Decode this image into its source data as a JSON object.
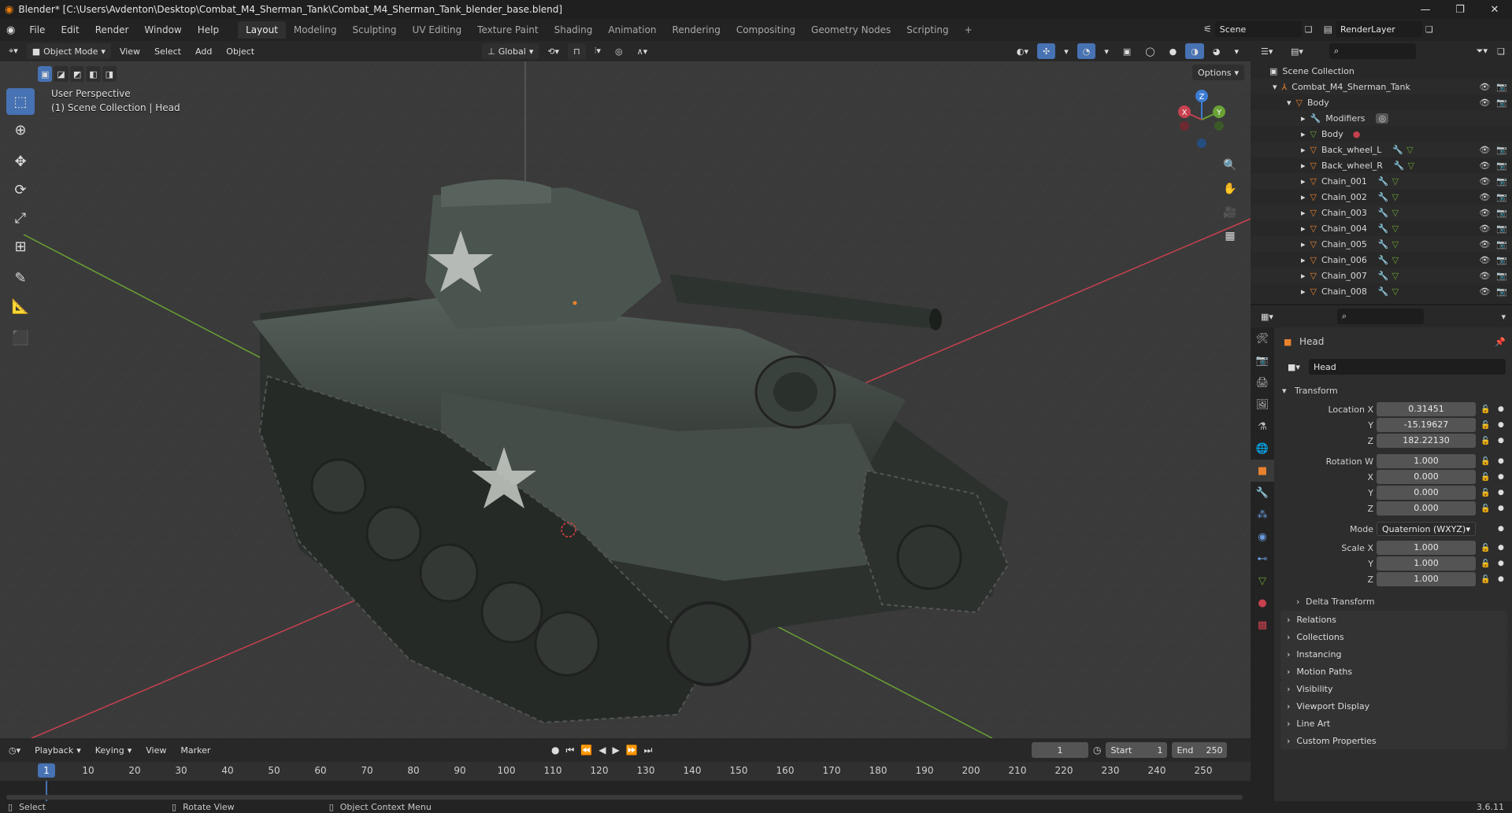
{
  "window": {
    "title": "Blender* [C:\\Users\\Avdenton\\Desktop\\Combat_M4_Sherman_Tank\\Combat_M4_Sherman_Tank_blender_base.blend]",
    "controls": [
      "—",
      "❐",
      "✕"
    ]
  },
  "menubar": {
    "menus": [
      "File",
      "Edit",
      "Render",
      "Window",
      "Help"
    ],
    "workspaces": [
      "Layout",
      "Modeling",
      "Sculpting",
      "UV Editing",
      "Texture Paint",
      "Shading",
      "Animation",
      "Rendering",
      "Compositing",
      "Geometry Nodes",
      "Scripting"
    ],
    "active_workspace": "Layout",
    "add_tab": "+",
    "scene": "Scene",
    "render_layer": "RenderLayer"
  },
  "viewport_header": {
    "mode": "Object Mode",
    "menus": [
      "View",
      "Select",
      "Add",
      "Object"
    ],
    "orientation": "Global",
    "options": "Options"
  },
  "viewport": {
    "perspective": "User Perspective",
    "collection_info": "(1) Scene Collection | Head",
    "gizmo_axes": [
      "Z",
      "Y",
      "X"
    ]
  },
  "toolbar": {
    "tools": [
      "select-box",
      "cursor",
      "move",
      "rotate",
      "scale",
      "transform",
      "annotate",
      "measure",
      "add-cube"
    ],
    "active_tool": "select-box"
  },
  "timeline": {
    "menus": [
      "Playback",
      "Keying",
      "View",
      "Marker"
    ],
    "current_frame": "1",
    "start_label": "Start",
    "start": "1",
    "end_label": "End",
    "end": "250",
    "ruler": [
      "10",
      "20",
      "30",
      "40",
      "50",
      "60",
      "70",
      "80",
      "90",
      "100",
      "110",
      "120",
      "130",
      "140",
      "150",
      "160",
      "170",
      "180",
      "190",
      "200",
      "210",
      "220",
      "230",
      "240",
      "250"
    ]
  },
  "statusbar": {
    "select": "Select",
    "rotate": "Rotate View",
    "context": "Object Context Menu",
    "version": "3.6.11"
  },
  "outliner": {
    "root": "Scene Collection",
    "collection": "Combat_M4_Sherman_Tank",
    "rows": [
      {
        "label": "Body",
        "indent": 2
      },
      {
        "label": "Modifiers",
        "indent": 3
      },
      {
        "label": "Body",
        "indent": 3
      },
      {
        "label": "Back_wheel_L",
        "indent": 3
      },
      {
        "label": "Back_wheel_R",
        "indent": 3
      },
      {
        "label": "Chain_001",
        "indent": 3
      },
      {
        "label": "Chain_002",
        "indent": 3
      },
      {
        "label": "Chain_003",
        "indent": 3
      },
      {
        "label": "Chain_004",
        "indent": 3
      },
      {
        "label": "Chain_005",
        "indent": 3
      },
      {
        "label": "Chain_006",
        "indent": 3
      },
      {
        "label": "Chain_007",
        "indent": 3
      },
      {
        "label": "Chain_008",
        "indent": 3
      }
    ]
  },
  "properties": {
    "object_name_header": "Head",
    "object_name": "Head",
    "transform": {
      "title": "Transform",
      "location": {
        "label_x": "Location X",
        "x": "0.31451",
        "y": "-15.19627",
        "z": "182.22130"
      },
      "rotation": {
        "label_w": "Rotation W",
        "w": "1.000",
        "x": "0.000",
        "y": "0.000",
        "z": "0.000"
      },
      "mode_label": "Mode",
      "mode": "Quaternion (WXYZ)",
      "scale": {
        "label_x": "Scale X",
        "x": "1.000",
        "y": "1.000",
        "z": "1.000"
      },
      "axis_y": "Y",
      "axis_z": "Z",
      "axis_x": "X",
      "delta": "Delta Transform"
    },
    "sections": [
      "Relations",
      "Collections",
      "Instancing",
      "Motion Paths",
      "Visibility",
      "Viewport Display",
      "Line Art",
      "Custom Properties"
    ]
  },
  "colors": {
    "accent": "#4772b3",
    "x_axis": "#c8414e",
    "y_axis": "#6aa235",
    "z_axis": "#3b7cd4",
    "object_orange": "#e8822e",
    "tank": "#3c4640"
  }
}
